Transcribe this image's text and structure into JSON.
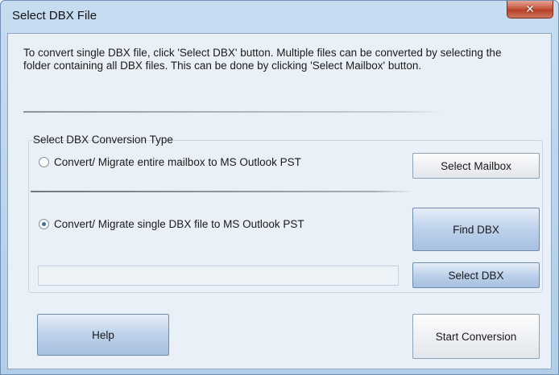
{
  "window": {
    "title": "Select DBX File",
    "close_label": "✕"
  },
  "info": {
    "text": "To convert single DBX file, click 'Select DBX' button. Multiple files can be converted by selecting the folder containing all DBX files. This can be done by clicking 'Select Mailbox' button."
  },
  "conversion_group": {
    "label": "Select DBX Conversion Type",
    "options": [
      {
        "label": "Convert/ Migrate entire mailbox to MS Outlook PST",
        "checked": false
      },
      {
        "label": "Convert/ Migrate single DBX file to MS Outlook PST",
        "checked": true
      }
    ],
    "path_value": ""
  },
  "buttons": {
    "select_mailbox": "Select Mailbox",
    "find_dbx": "Find DBX",
    "select_dbx": "Select DBX",
    "help": "Help",
    "start_conversion": "Start Conversion"
  },
  "colors": {
    "window_frame": "#b3cde8",
    "client_bg": "#eaf0f7",
    "close_red": "#c75a43",
    "button_blue": "#bcd1ea"
  }
}
